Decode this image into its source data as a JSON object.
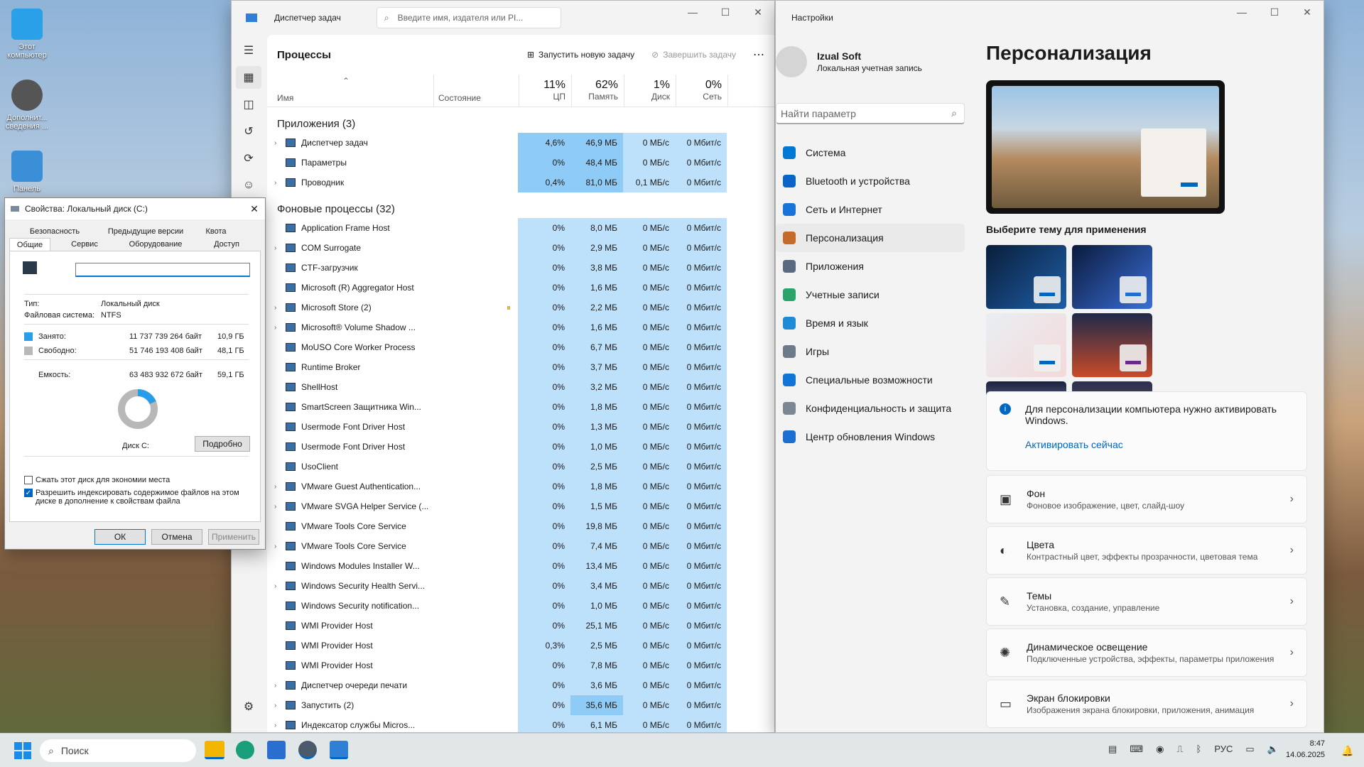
{
  "desktop": {
    "icons": [
      {
        "label": "Этот компьютер"
      },
      {
        "label": "Дополнит... сведения ..."
      },
      {
        "label": "Панель"
      }
    ]
  },
  "taskmgr": {
    "title": "Диспетчер задач",
    "search_placeholder": "Введите имя, издателя или PI...",
    "section_title": "Процессы",
    "run_new_task": "Запустить новую задачу",
    "end_task": "Завершить задачу",
    "columns": {
      "name": "Имя",
      "status": "Состояние",
      "cpu_pct": "11%",
      "cpu": "ЦП",
      "mem_pct": "62%",
      "mem": "Память",
      "disk_pct": "1%",
      "disk": "Диск",
      "net_pct": "0%",
      "net": "Сеть"
    },
    "group_apps": "Приложения (3)",
    "group_bg": "Фоновые процессы (32)",
    "apps": [
      {
        "name": "Диспетчер задач",
        "cpu": "4,6%",
        "mem": "46,9 МБ",
        "disk": "0 МБ/с",
        "net": "0 Мбит/с"
      },
      {
        "name": "Параметры",
        "cpu": "0%",
        "mem": "48,4 МБ",
        "disk": "0 МБ/с",
        "net": "0 Мбит/с"
      },
      {
        "name": "Проводник",
        "cpu": "0,4%",
        "mem": "81,0 МБ",
        "disk": "0,1 МБ/с",
        "net": "0 Мбит/с"
      }
    ],
    "bg": [
      {
        "name": "Application Frame Host",
        "cpu": "0%",
        "mem": "8,0 МБ",
        "disk": "0 МБ/с",
        "net": "0 Мбит/с"
      },
      {
        "name": "COM Surrogate",
        "cpu": "0%",
        "mem": "2,9 МБ",
        "disk": "0 МБ/с",
        "net": "0 Мбит/с"
      },
      {
        "name": "CTF-загрузчик",
        "cpu": "0%",
        "mem": "3,8 МБ",
        "disk": "0 МБ/с",
        "net": "0 Мбит/с"
      },
      {
        "name": "Microsoft (R) Aggregator Host",
        "cpu": "0%",
        "mem": "1,6 МБ",
        "disk": "0 МБ/с",
        "net": "0 Мбит/с"
      },
      {
        "name": "Microsoft Store (2)",
        "cpu": "0%",
        "mem": "2,2 МБ",
        "disk": "0 МБ/с",
        "net": "0 Мбит/с"
      },
      {
        "name": "Microsoft® Volume Shadow ...",
        "cpu": "0%",
        "mem": "1,6 МБ",
        "disk": "0 МБ/с",
        "net": "0 Мбит/с"
      },
      {
        "name": "MoUSO Core Worker Process",
        "cpu": "0%",
        "mem": "6,7 МБ",
        "disk": "0 МБ/с",
        "net": "0 Мбит/с"
      },
      {
        "name": "Runtime Broker",
        "cpu": "0%",
        "mem": "3,7 МБ",
        "disk": "0 МБ/с",
        "net": "0 Мбит/с"
      },
      {
        "name": "ShellHost",
        "cpu": "0%",
        "mem": "3,2 МБ",
        "disk": "0 МБ/с",
        "net": "0 Мбит/с"
      },
      {
        "name": "SmartScreen Защитника Win...",
        "cpu": "0%",
        "mem": "1,8 МБ",
        "disk": "0 МБ/с",
        "net": "0 Мбит/с"
      },
      {
        "name": "Usermode Font Driver Host",
        "cpu": "0%",
        "mem": "1,3 МБ",
        "disk": "0 МБ/с",
        "net": "0 Мбит/с"
      },
      {
        "name": "Usermode Font Driver Host",
        "cpu": "0%",
        "mem": "1,0 МБ",
        "disk": "0 МБ/с",
        "net": "0 Мбит/с"
      },
      {
        "name": "UsoClient",
        "cpu": "0%",
        "mem": "2,5 МБ",
        "disk": "0 МБ/с",
        "net": "0 Мбит/с"
      },
      {
        "name": "VMware Guest Authentication...",
        "cpu": "0%",
        "mem": "1,8 МБ",
        "disk": "0 МБ/с",
        "net": "0 Мбит/с"
      },
      {
        "name": "VMware SVGA Helper Service (...",
        "cpu": "0%",
        "mem": "1,5 МБ",
        "disk": "0 МБ/с",
        "net": "0 Мбит/с"
      },
      {
        "name": "VMware Tools Core Service",
        "cpu": "0%",
        "mem": "19,8 МБ",
        "disk": "0 МБ/с",
        "net": "0 Мбит/с"
      },
      {
        "name": "VMware Tools Core Service",
        "cpu": "0%",
        "mem": "7,4 МБ",
        "disk": "0 МБ/с",
        "net": "0 Мбит/с"
      },
      {
        "name": "Windows Modules Installer W...",
        "cpu": "0%",
        "mem": "13,4 МБ",
        "disk": "0 МБ/с",
        "net": "0 Мбит/с"
      },
      {
        "name": "Windows Security Health Servi...",
        "cpu": "0%",
        "mem": "3,4 МБ",
        "disk": "0 МБ/с",
        "net": "0 Мбит/с"
      },
      {
        "name": "Windows Security notification...",
        "cpu": "0%",
        "mem": "1,0 МБ",
        "disk": "0 МБ/с",
        "net": "0 Мбит/с"
      },
      {
        "name": "WMI Provider Host",
        "cpu": "0%",
        "mem": "25,1 МБ",
        "disk": "0 МБ/с",
        "net": "0 Мбит/с"
      },
      {
        "name": "WMI Provider Host",
        "cpu": "0,3%",
        "mem": "2,5 МБ",
        "disk": "0 МБ/с",
        "net": "0 Мбит/с"
      },
      {
        "name": "WMI Provider Host",
        "cpu": "0%",
        "mem": "7,8 МБ",
        "disk": "0 МБ/с",
        "net": "0 Мбит/с"
      },
      {
        "name": "Диспетчер очереди печати",
        "cpu": "0%",
        "mem": "3,6 МБ",
        "disk": "0 МБ/с",
        "net": "0 Мбит/с"
      },
      {
        "name": "Запустить (2)",
        "cpu": "0%",
        "mem": "35,6 МБ",
        "disk": "0 МБ/с",
        "net": "0 Мбит/с"
      },
      {
        "name": "Индексатор службы Micros...",
        "cpu": "0%",
        "mem": "6,1 МБ",
        "disk": "0 МБ/с",
        "net": "0 Мбит/с"
      }
    ]
  },
  "settings": {
    "title": "Настройки",
    "user_name": "Izual Soft",
    "user_type": "Локальная учетная запись",
    "search_placeholder": "Найти параметр",
    "page_title": "Персонализация",
    "theme_prompt": "Выберите тему для применения",
    "nav": [
      {
        "label": "Система",
        "color": "#0078d4"
      },
      {
        "label": "Bluetooth и устройства",
        "color": "#0a64c8"
      },
      {
        "label": "Сеть и Интернет",
        "color": "#1a73d9"
      },
      {
        "label": "Персонализация",
        "color": "#c46a2a"
      },
      {
        "label": "Приложения",
        "color": "#5b6a80"
      },
      {
        "label": "Учетные записи",
        "color": "#2ca36b"
      },
      {
        "label": "Время и язык",
        "color": "#1f8ad6"
      },
      {
        "label": "Игры",
        "color": "#6c7a8a"
      },
      {
        "label": "Специальные возможности",
        "color": "#1274d6"
      },
      {
        "label": "Конфиденциальность и защита",
        "color": "#7c8794"
      },
      {
        "label": "Центр обновления Windows",
        "color": "#1a6fd0"
      }
    ],
    "activate_msg": "Для персонализации компьютера нужно активировать Windows.",
    "activate_link": "Активировать сейчас",
    "cards": [
      {
        "title": "Фон",
        "sub": "Фоновое изображение, цвет, слайд-шоу"
      },
      {
        "title": "Цвета",
        "sub": "Контрастный цвет, эффекты прозрачности, цветовая тема"
      },
      {
        "title": "Темы",
        "sub": "Установка, создание, управление"
      },
      {
        "title": "Динамическое освещение",
        "sub": "Подключенные устройства, эффекты, параметры приложения"
      },
      {
        "title": "Экран блокировки",
        "sub": "Изображения экрана блокировки, приложения, анимация"
      }
    ]
  },
  "props": {
    "title": "Свойства: Локальный диск (C:)",
    "tabs_top": [
      "Безопасность",
      "Предыдущие версии",
      "Квота"
    ],
    "tabs_bottom": [
      "Общие",
      "Сервис",
      "Оборудование",
      "Доступ"
    ],
    "type_label": "Тип:",
    "type_value": "Локальный диск",
    "fs_label": "Файловая система:",
    "fs_value": "NTFS",
    "used_label": "Занято:",
    "used_bytes": "11 737 739 264 байт",
    "used_gb": "10,9 ГБ",
    "free_label": "Свободно:",
    "free_bytes": "51 746 193 408 байт",
    "free_gb": "48,1 ГБ",
    "cap_label": "Емкость:",
    "cap_bytes": "63 483 932 672 байт",
    "cap_gb": "59,1 ГБ",
    "used_fraction": 0.185,
    "disk_label": "Диск C:",
    "details_btn": "Подробно",
    "compress": "Сжать этот диск для экономии места",
    "index": "Разрешить индексировать содержимое файлов на этом диске в дополнение к свойствам файла",
    "ok": "ОК",
    "cancel": "Отмена",
    "apply": "Применить"
  },
  "taskbar": {
    "search": "Поиск",
    "lang": "РУС",
    "time": "8:47",
    "date": "14.06.2025"
  }
}
